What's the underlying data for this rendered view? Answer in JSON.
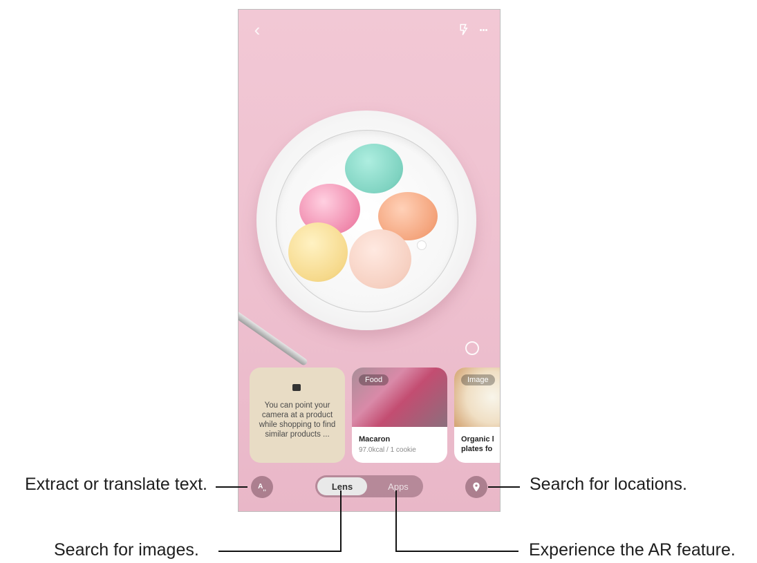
{
  "top": {
    "back_icon": "back-icon",
    "flash_icon": "flash-icon",
    "more_icon": "more-icon"
  },
  "cards": {
    "tip": {
      "text": "You can point your camera at a product while shopping to find similar products ..."
    },
    "food": {
      "tag": "Food",
      "title": "Macaron",
      "subtitle": "97.0kcal / 1 cookie"
    },
    "image": {
      "tag": "Image",
      "title": "Organic l",
      "subtitle": "plates fo"
    }
  },
  "bottom": {
    "lens_label": "Lens",
    "apps_label": "Apps"
  },
  "callouts": {
    "extract": "Extract or translate text.",
    "locations": "Search for locations.",
    "images": "Search for images.",
    "ar": "Experience the AR feature."
  },
  "colors": {
    "background_pink": "#eec0cf",
    "tip_card": "#e8dcc5",
    "segment_bg": "#7a5460"
  }
}
